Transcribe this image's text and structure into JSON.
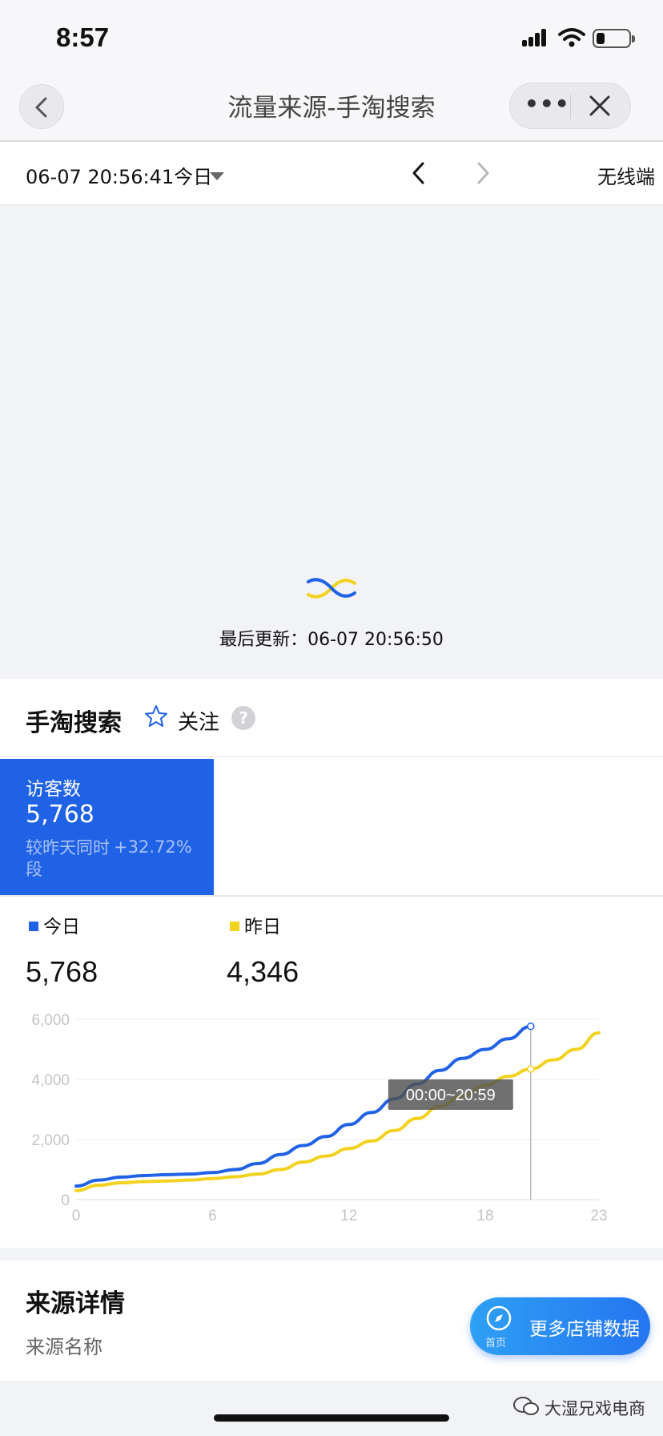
{
  "status_bar": {
    "time": "8:57"
  },
  "nav": {
    "title": "流量来源-手淘搜索"
  },
  "date_bar": {
    "date": "06-07 20:56:41今日",
    "device": "无线端"
  },
  "loading": {
    "last_update": "最后更新：06-07 20:56:50"
  },
  "section": {
    "title": "手淘搜索",
    "follow": "关注",
    "help": "?"
  },
  "metric": {
    "label": "访客数",
    "value": "5,768",
    "compare_label": "较昨天同时段",
    "change": "+32.72%"
  },
  "legend": {
    "today": {
      "label": "今日",
      "value": "5,768",
      "color": "#2062e5"
    },
    "yesterday": {
      "label": "昨日",
      "value": "4,346",
      "color": "#f2d21f"
    }
  },
  "tooltip": {
    "text": "00:00~20:59"
  },
  "chart_data": {
    "type": "line",
    "x": [
      0,
      1,
      2,
      3,
      4,
      5,
      6,
      7,
      8,
      9,
      10,
      11,
      12,
      13,
      14,
      15,
      16,
      17,
      18,
      19,
      20,
      21,
      22,
      23
    ],
    "series": [
      {
        "name": "今日",
        "values": [
          450,
          650,
          750,
          800,
          830,
          850,
          900,
          1000,
          1200,
          1500,
          1800,
          2100,
          2500,
          2900,
          3350,
          3850,
          4300,
          4700,
          5000,
          5350,
          5768
        ]
      },
      {
        "name": "昨日",
        "values": [
          300,
          480,
          560,
          600,
          620,
          650,
          700,
          760,
          850,
          1000,
          1250,
          1450,
          1700,
          1950,
          2300,
          2700,
          3100,
          3450,
          3800,
          4100,
          4346,
          4650,
          5000,
          5550
        ]
      }
    ],
    "xticks": [
      "0",
      "6",
      "12",
      "18",
      "23"
    ],
    "yticks": [
      "0",
      "2,000",
      "4,000",
      "6,000"
    ],
    "xlim": [
      0,
      23
    ],
    "ylim": [
      0,
      6000
    ],
    "grid": true,
    "marker_x": 20
  },
  "footer": {
    "title": "来源详情",
    "subtitle": "来源名称"
  },
  "fab": {
    "label": "更多店铺数据",
    "icon_label": "首页"
  },
  "watermark": {
    "text": "大湿兄戏电商"
  }
}
